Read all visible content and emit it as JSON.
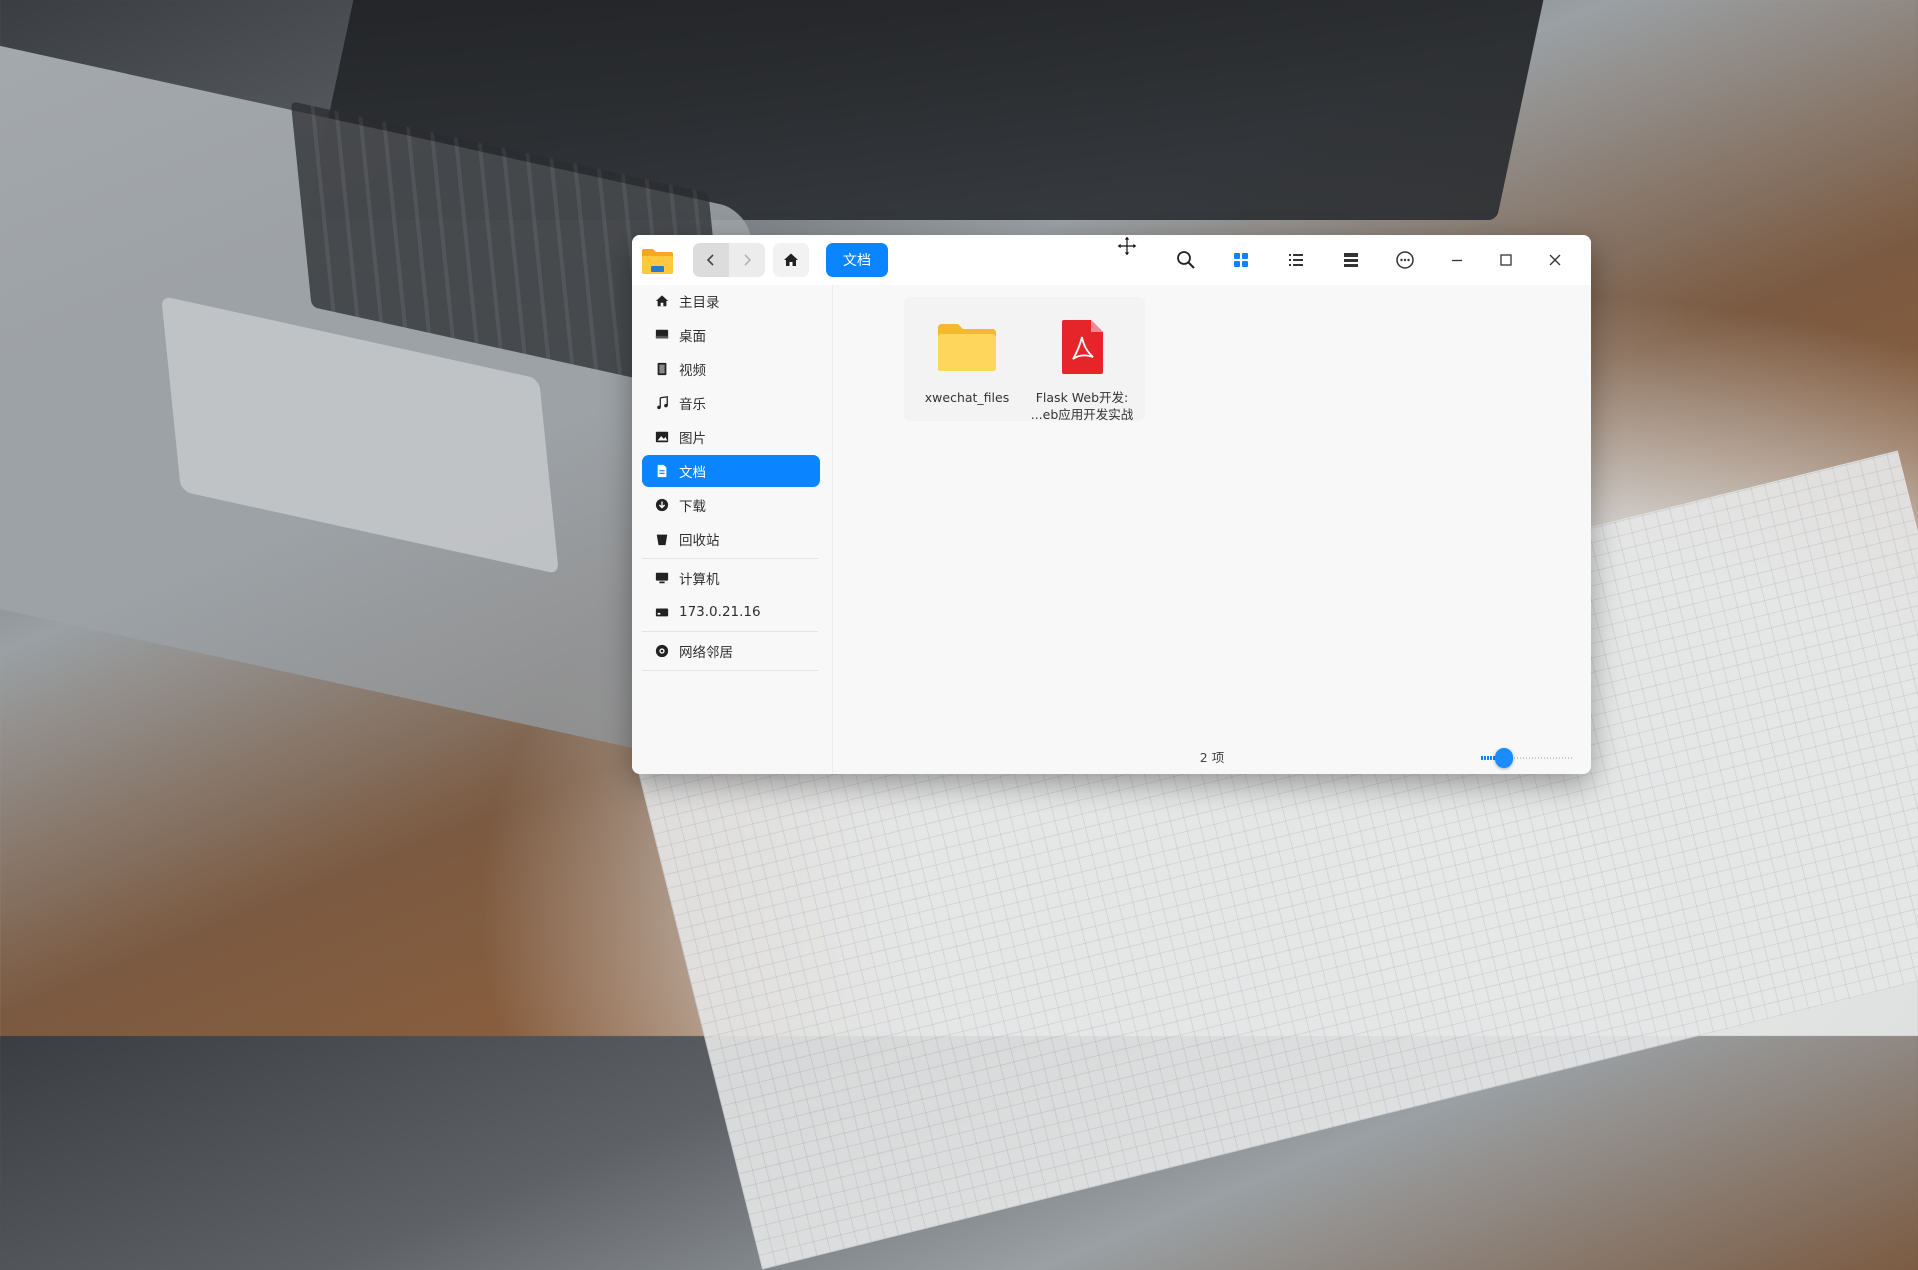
{
  "window": {
    "breadcrumb": "文档",
    "status_text": "2 项",
    "icon_size_level": 0.25
  },
  "toolbar": {
    "icons": [
      "folder-app-icon",
      "back-icon",
      "forward-icon",
      "home-icon",
      "search-icon",
      "icon-view-icon",
      "list-view-icon",
      "detail-view-icon",
      "more-icon",
      "minimize-icon",
      "maximize-icon",
      "close-icon"
    ]
  },
  "sidebar": {
    "items": [
      {
        "label": "主目录",
        "icon": "home-icon"
      },
      {
        "label": "桌面",
        "icon": "desktop-icon"
      },
      {
        "label": "视频",
        "icon": "video-icon"
      },
      {
        "label": "音乐",
        "icon": "music-icon"
      },
      {
        "label": "图片",
        "icon": "picture-icon"
      },
      {
        "label": "文档",
        "icon": "document-icon",
        "selected": true
      },
      {
        "label": "下载",
        "icon": "download-icon"
      },
      {
        "label": "回收站",
        "icon": "trash-icon"
      },
      {
        "label": "计算机",
        "icon": "computer-icon"
      },
      {
        "label": "173.0.21.16",
        "icon": "network-drive-icon"
      },
      {
        "label": "网络邻居",
        "icon": "network-icon"
      }
    ]
  },
  "files": [
    {
      "name": "xwechat_files",
      "type": "folder"
    },
    {
      "name_line1": "Flask Web开发:",
      "name_line2": "...eb应用开发实战",
      "type": "pdf"
    }
  ],
  "colors": {
    "accent": "#0a84ff",
    "folder": "#f7c948",
    "pdf": "#e5252a"
  }
}
